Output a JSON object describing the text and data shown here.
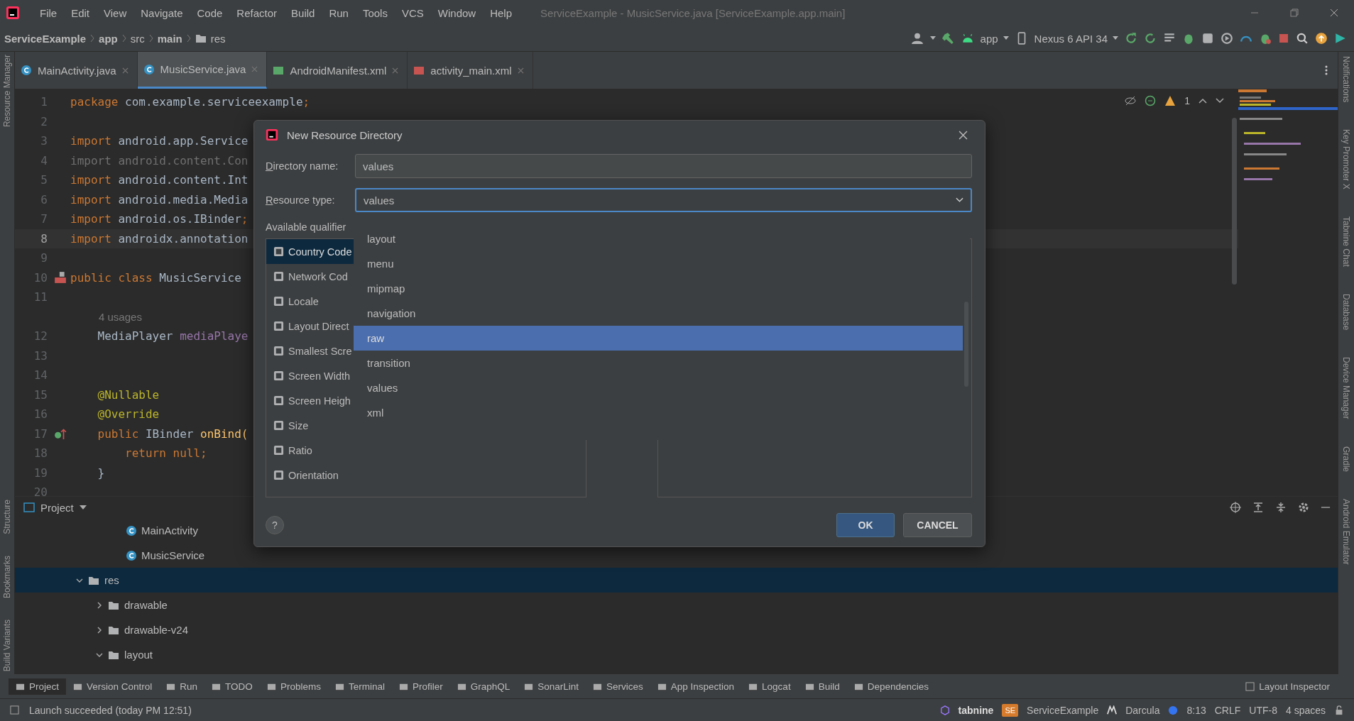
{
  "menu": [
    "File",
    "Edit",
    "View",
    "Navigate",
    "Code",
    "Refactor",
    "Build",
    "Run",
    "Tools",
    "VCS",
    "Window",
    "Help"
  ],
  "window": {
    "title": "ServiceExample - MusicService.java [ServiceExample.app.main]"
  },
  "breadcrumb": [
    {
      "label": "ServiceExample",
      "bold": true
    },
    {
      "label": "app",
      "bold": true
    },
    {
      "label": "src",
      "bold": false
    },
    {
      "label": "main",
      "bold": true
    },
    {
      "label": "res",
      "bold": false
    }
  ],
  "run_config": {
    "module": "app",
    "device": "Nexus 6 API 34"
  },
  "tabs": [
    {
      "label": "MainActivity.java",
      "kind": "java",
      "selected": false
    },
    {
      "label": "MusicService.java",
      "kind": "java",
      "selected": true
    },
    {
      "label": "AndroidManifest.xml",
      "kind": "manifest",
      "selected": false
    },
    {
      "label": "activity_main.xml",
      "kind": "layout",
      "selected": false
    }
  ],
  "left_strip": {
    "top": [
      "Resource Manager"
    ],
    "bottom": [
      "Structure",
      "Bookmarks",
      "Build Variants"
    ]
  },
  "right_strip": [
    "Notifications",
    "Key Promoter X",
    "Tabnine Chat",
    "Database",
    "Device Manager",
    "Gradle",
    "Android Emulator"
  ],
  "editor": {
    "warnings": "1",
    "lines": [
      {
        "kind": "code",
        "number": "1",
        "current": false,
        "parts": [
          {
            "kind": "kw",
            "text": "package "
          },
          {
            "kind": "plain",
            "text": "com.example.serviceexample"
          },
          {
            "kind": "kw",
            "text": ";"
          }
        ]
      },
      {
        "kind": "code",
        "number": "2",
        "current": false
      },
      {
        "kind": "code",
        "number": "3",
        "current": false,
        "parts": [
          {
            "kind": "kw",
            "text": "import "
          },
          {
            "kind": "plain",
            "text": "android.app.Service"
          }
        ]
      },
      {
        "kind": "code",
        "number": "4",
        "current": false,
        "parts": [
          {
            "kind": "dim",
            "text": "import android.content.Con"
          }
        ]
      },
      {
        "kind": "code",
        "number": "5",
        "current": false,
        "parts": [
          {
            "kind": "kw",
            "text": "import "
          },
          {
            "kind": "plain",
            "text": "android.content.Int"
          }
        ]
      },
      {
        "kind": "code",
        "number": "6",
        "current": false,
        "parts": [
          {
            "kind": "kw",
            "text": "import "
          },
          {
            "kind": "plain",
            "text": "android.media.Media"
          }
        ]
      },
      {
        "kind": "code",
        "number": "7",
        "current": false,
        "parts": [
          {
            "kind": "kw",
            "text": "import "
          },
          {
            "kind": "plain",
            "text": "android.os.IBinder"
          },
          {
            "kind": "kw",
            "text": ";"
          }
        ]
      },
      {
        "kind": "code",
        "number": "8",
        "current": true,
        "parts": [
          {
            "kind": "kw",
            "text": "import "
          },
          {
            "kind": "plain",
            "text": "androidx.annotation"
          }
        ]
      },
      {
        "kind": "code",
        "number": "9",
        "current": false
      },
      {
        "kind": "code",
        "number": "10",
        "current": false,
        "gutter": {
          "kind": "class"
        },
        "parts": [
          {
            "kind": "kw",
            "text": "public class "
          },
          {
            "kind": "plain",
            "text": "MusicService"
          }
        ]
      },
      {
        "kind": "code",
        "number": "11",
        "current": false
      },
      {
        "kind": "hint",
        "text": "4 usages"
      },
      {
        "kind": "code",
        "number": "12",
        "current": false,
        "parts": [
          {
            "kind": "plain",
            "text": "    MediaPlayer "
          },
          {
            "kind": "field",
            "text": "mediaPlaye"
          }
        ]
      },
      {
        "kind": "code",
        "number": "13",
        "current": false
      },
      {
        "kind": "code",
        "number": "14",
        "current": false
      },
      {
        "kind": "code",
        "number": "15",
        "current": false,
        "parts": [
          {
            "kind": "ann",
            "text": "    @Nullable"
          }
        ]
      },
      {
        "kind": "code",
        "number": "16",
        "current": false,
        "parts": [
          {
            "kind": "ann",
            "text": "    @Override"
          }
        ]
      },
      {
        "kind": "code",
        "number": "17",
        "current": false,
        "gutter": {
          "kind": "override"
        },
        "parts": [
          {
            "kind": "kw",
            "text": "    public "
          },
          {
            "kind": "plain",
            "text": "IBinder "
          },
          {
            "kind": "method",
            "text": "onBind("
          }
        ]
      },
      {
        "kind": "code",
        "number": "18",
        "current": false,
        "parts": [
          {
            "kind": "kw",
            "text": "        return null;"
          }
        ]
      },
      {
        "kind": "code",
        "number": "19",
        "current": false,
        "parts": [
          {
            "kind": "plain",
            "text": "    }"
          }
        ]
      },
      {
        "kind": "code",
        "number": "20",
        "current": false
      }
    ]
  },
  "project": {
    "title": "Project",
    "tree": [
      {
        "label": "MainActivity",
        "kind": "class",
        "selected": false
      },
      {
        "label": "MusicService",
        "kind": "class",
        "selected": false
      },
      {
        "label": "res",
        "kind": "folder",
        "selected": true,
        "expanded": true,
        "children": [
          {
            "label": "drawable",
            "selected": false,
            "expanded": false
          },
          {
            "label": "drawable-v24",
            "selected": false,
            "expanded": false
          },
          {
            "label": "layout",
            "selected": false,
            "expanded": true
          }
        ]
      }
    ]
  },
  "tool_windows": [
    {
      "label": "Project",
      "selected": true
    },
    {
      "label": "Version Control",
      "selected": false
    },
    {
      "label": "Run",
      "selected": false
    },
    {
      "label": "TODO",
      "selected": false
    },
    {
      "label": "Problems",
      "selected": false
    },
    {
      "label": "Terminal",
      "selected": false
    },
    {
      "label": "Profiler",
      "selected": false
    },
    {
      "label": "GraphQL",
      "selected": false
    },
    {
      "label": "SonarLint",
      "selected": false
    },
    {
      "label": "Services",
      "selected": false
    },
    {
      "label": "App Inspection",
      "selected": false
    },
    {
      "label": "Logcat",
      "selected": false
    },
    {
      "label": "Build",
      "selected": false
    },
    {
      "label": "Dependencies",
      "selected": false
    }
  ],
  "layout_inspector": "Layout Inspector",
  "status_bar": {
    "message": "Launch succeeded (today PM 12:51)",
    "plugin": "tabnine",
    "project_badge": "SE",
    "project": "ServiceExample",
    "theme": "Darcula",
    "position": "8:13",
    "line_separator": "CRLF",
    "encoding": "UTF-8",
    "indent": "4 spaces"
  },
  "dialog": {
    "title": "New Resource Directory",
    "directory_label": "Directory name:",
    "directory_value": "values",
    "type_label": "Resource type:",
    "type_value": "values",
    "qualifiers_label": "Available qualifier",
    "qualifiers": [
      {
        "label": "Country Code",
        "selected": true
      },
      {
        "label": "Network Cod",
        "selected": false
      },
      {
        "label": "Locale",
        "selected": false
      },
      {
        "label": "Layout Direct",
        "selected": false
      },
      {
        "label": "Smallest Scre",
        "selected": false
      },
      {
        "label": "Screen Width",
        "selected": false
      },
      {
        "label": "Screen Heigh",
        "selected": false
      },
      {
        "label": "Size",
        "selected": false
      },
      {
        "label": "Ratio",
        "selected": false
      },
      {
        "label": "Orientation",
        "selected": false
      }
    ],
    "options": [
      {
        "label": "layout",
        "selected": false
      },
      {
        "label": "menu",
        "selected": false
      },
      {
        "label": "mipmap",
        "selected": false
      },
      {
        "label": "navigation",
        "selected": false
      },
      {
        "label": "raw",
        "selected": true
      },
      {
        "label": "transition",
        "selected": false
      },
      {
        "label": "values",
        "selected": false
      },
      {
        "label": "xml",
        "selected": false
      }
    ],
    "help": "?",
    "ok": "OK",
    "cancel": "CANCEL"
  }
}
